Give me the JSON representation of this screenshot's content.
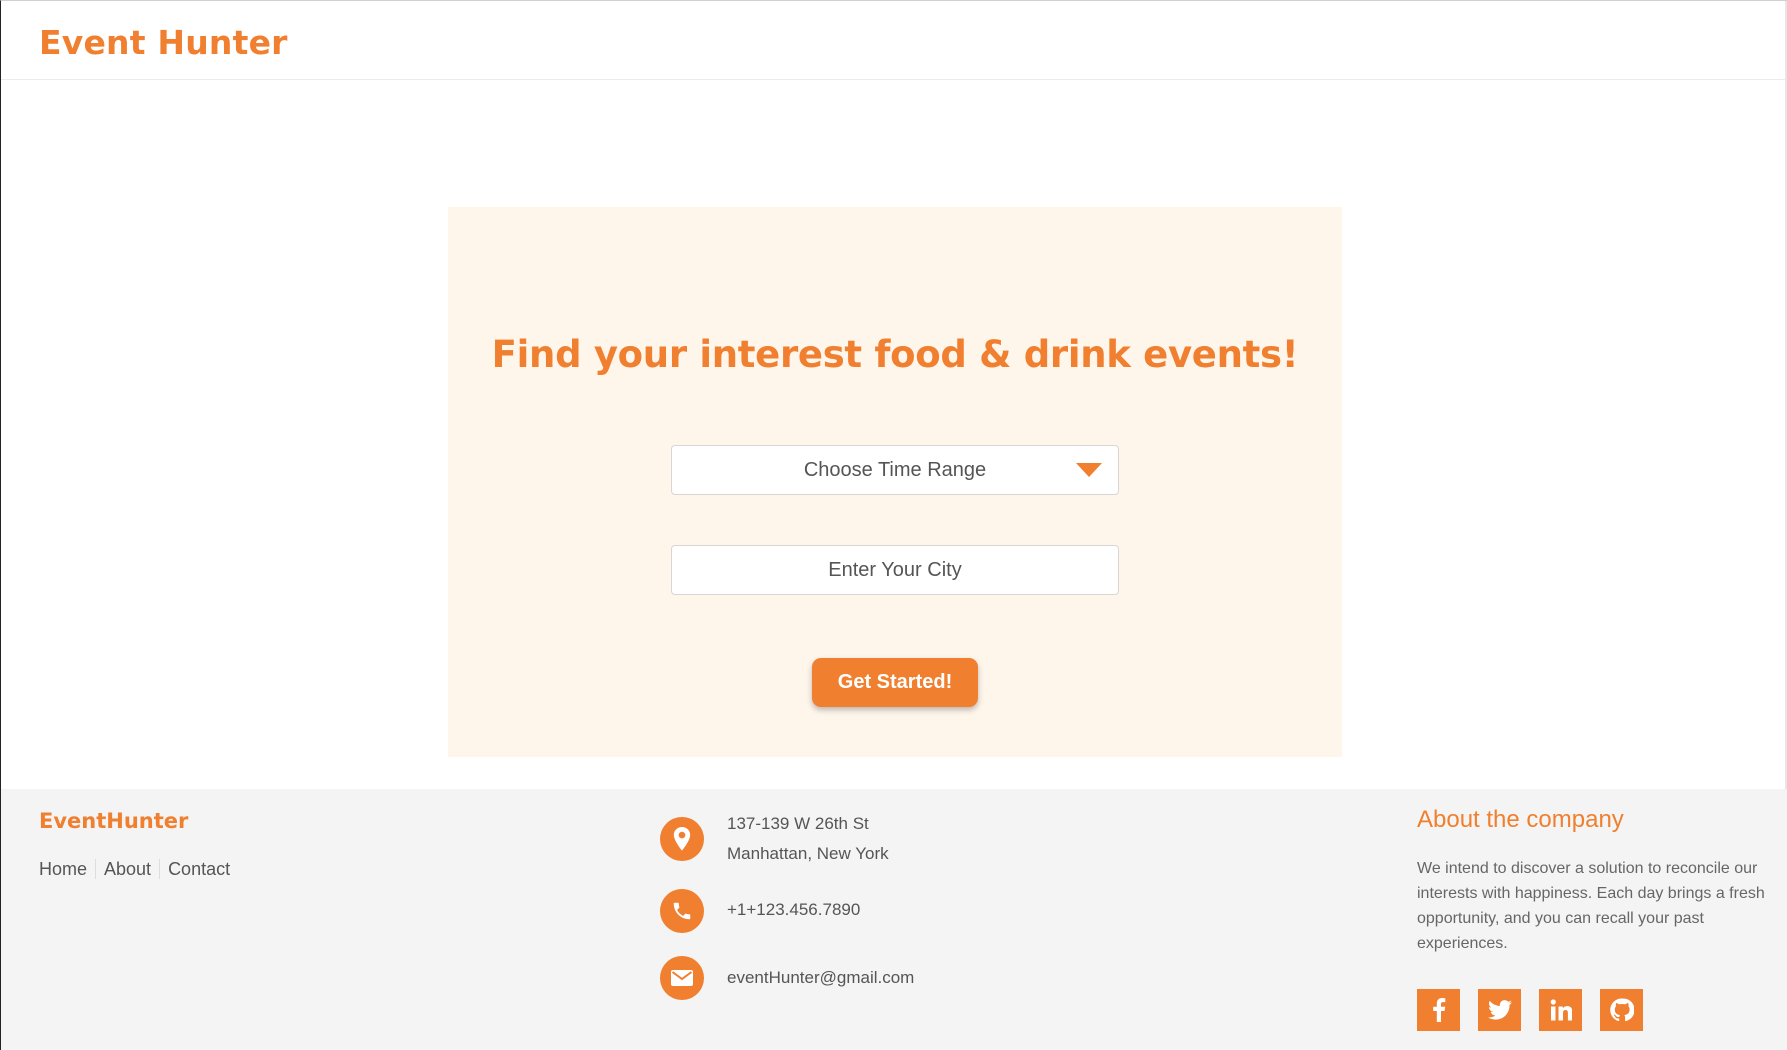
{
  "header": {
    "brand": "Event Hunter"
  },
  "hero": {
    "title": "Find your interest food & drink events!",
    "time_range_select": {
      "selected": "Choose Time Range",
      "icon": "caret-down-icon"
    },
    "city_input": {
      "placeholder": "Enter Your City",
      "value": ""
    },
    "cta_label": "Get Started!"
  },
  "footer": {
    "brand": "EventHunter",
    "links": [
      "Home",
      "About",
      "Contact"
    ],
    "contact": {
      "address_line1": "137-139 W 26th St",
      "address_line2": "Manhattan, New York",
      "phone": "+1+123.456.7890",
      "email": "eventHunter@gmail.com"
    },
    "about": {
      "title": "About the company",
      "text": "We intend to discover a solution to reconcile our interests with happiness. Each day brings a fresh opportunity, and you can recall your past experiences."
    },
    "socials": [
      "facebook-icon",
      "twitter-icon",
      "linkedin-icon",
      "github-icon"
    ]
  },
  "colors": {
    "accent": "#f07f2f",
    "hero_bg": "#fef5eb",
    "footer_bg": "#f4f4f4"
  }
}
